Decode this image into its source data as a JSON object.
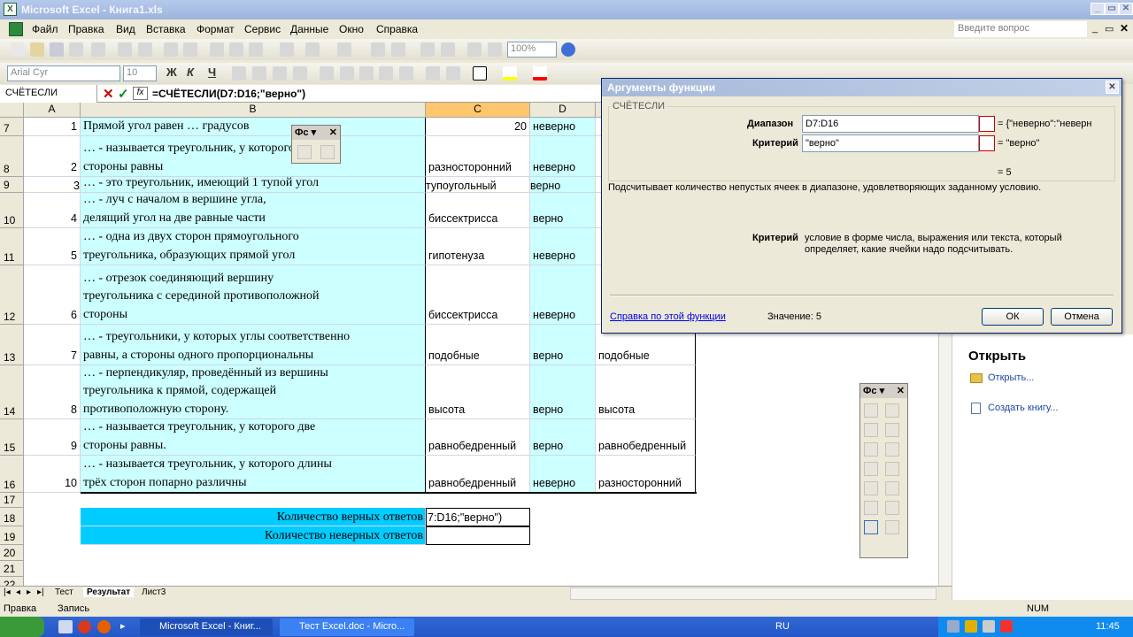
{
  "window": {
    "title": "Microsoft Excel - Книга1.xls"
  },
  "menu": [
    "Файл",
    "Правка",
    "Вид",
    "Вставка",
    "Формат",
    "Сервис",
    "Данные",
    "Окно",
    "Справка"
  ],
  "ask_placeholder": "Введите вопрос",
  "toolbar": {
    "zoom": "100%",
    "font": "Arial Cyr",
    "size": "10",
    "bold": "Ж",
    "italic": "К",
    "underline": "Ч"
  },
  "formula_bar": {
    "name_box": "СЧЁТЕСЛИ",
    "fx": "fx",
    "formula": "=СЧЁТЕСЛИ(D7:D16;\"верно\")"
  },
  "columns": [
    "A",
    "B",
    "C",
    "D"
  ],
  "rows": [
    {
      "n": "7",
      "a": "1",
      "b": [
        "Прямой угол равен … градусов"
      ],
      "c": "20",
      "d": "неверно",
      "e": ""
    },
    {
      "n": "8",
      "a": "2",
      "b": [
        "… - называется треугольник, у которого все три",
        "стороны равны"
      ],
      "c": "разносторонний",
      "d": "неверно",
      "e": ""
    },
    {
      "n": "9",
      "a": "3",
      "b": [
        "… - это треугольник, имеющий 1 тупой угол"
      ],
      "c": "тупоугольный",
      "d": "верно",
      "e": ""
    },
    {
      "n": "10",
      "a": "4",
      "b": [
        "… - луч с началом в вершине угла,",
        "делящий угол на две равные части"
      ],
      "c": "биссектрисса",
      "d": "верно",
      "e": ""
    },
    {
      "n": "11",
      "a": "5",
      "b": [
        "… - одна из двух сторон прямоугольного",
        "треугольника, образующих прямой угол"
      ],
      "c": "гипотенуза",
      "d": "неверно",
      "e": ""
    },
    {
      "n": "12",
      "a": "6",
      "b": [
        "… - отрезок соединяющий вершину",
        "треугольника с серединой противоположной",
        "стороны"
      ],
      "c": "биссектрисса",
      "d": "неверно",
      "e": ""
    },
    {
      "n": "13",
      "a": "7",
      "b": [
        "… - треугольники, у которых углы соответственно",
        "равны, а стороны одного пропорциональны"
      ],
      "c": "подобные",
      "d": "верно",
      "e": "подобные"
    },
    {
      "n": "14",
      "a": "8",
      "b": [
        "… - перпендикуляр, проведённый из вершины",
        "треугольника к прямой, содержащей",
        "противоположную сторону."
      ],
      "c": "высота",
      "d": "верно",
      "e": "высота"
    },
    {
      "n": "15",
      "a": "9",
      "b": [
        "… - называется треугольник, у которого две",
        "стороны равны."
      ],
      "c": "равнобедренный",
      "d": "верно",
      "e": "равнобедренный"
    },
    {
      "n": "16",
      "a": "10",
      "b": [
        "… - называется треугольник, у которого длины",
        "трёх сторон попарно различны"
      ],
      "c": "равнобедренный",
      "d": "неверно",
      "e": "разносторонний"
    }
  ],
  "extra_rows": [
    "17",
    "18",
    "19",
    "20",
    "21",
    "22"
  ],
  "summary": {
    "correct_label": "Количество верных ответов",
    "wrong_label": "Количество неверных ответов",
    "edit_text": "7:D16;\"верно\")"
  },
  "sheets": [
    "Тест",
    "Результат",
    "Лист3"
  ],
  "dialog": {
    "title": "Аргументы функции",
    "func": "СЧЁТЕСЛИ",
    "range_label": "Диапазон",
    "range_value": "D7:D16",
    "range_result": "= {\"неверно\":\"неверн",
    "criteria_label": "Критерий",
    "criteria_value": "\"верно\"",
    "criteria_result": "= \"верно\"",
    "result": "= 5",
    "description": "Подсчитывает количество непустых ячеек в диапазоне, удовлетворяющих заданному условию.",
    "help_title": "Критерий",
    "help_line1": "условие в форме числа, выражения или текста, который",
    "help_line2": "определяет, какие ячейки надо подсчитывать.",
    "help_link": "Справка по этой функции",
    "value_label": "Значение: 5",
    "ok": "ОК",
    "cancel": "Отмена"
  },
  "toolbox1": {
    "title": "Фс"
  },
  "toolbox2": {
    "title": "Фс"
  },
  "taskpane": {
    "heading": "Открыть",
    "open": "Открыть...",
    "create": "Создать книгу..."
  },
  "status": {
    "left": "Правка",
    "mode": "Запись",
    "num": "NUM"
  },
  "taskbar": {
    "task1": "Microsoft Excel - Книг...",
    "task2": "Тест Excel.doc - Micro...",
    "lang": "RU",
    "clock": "11:45"
  }
}
